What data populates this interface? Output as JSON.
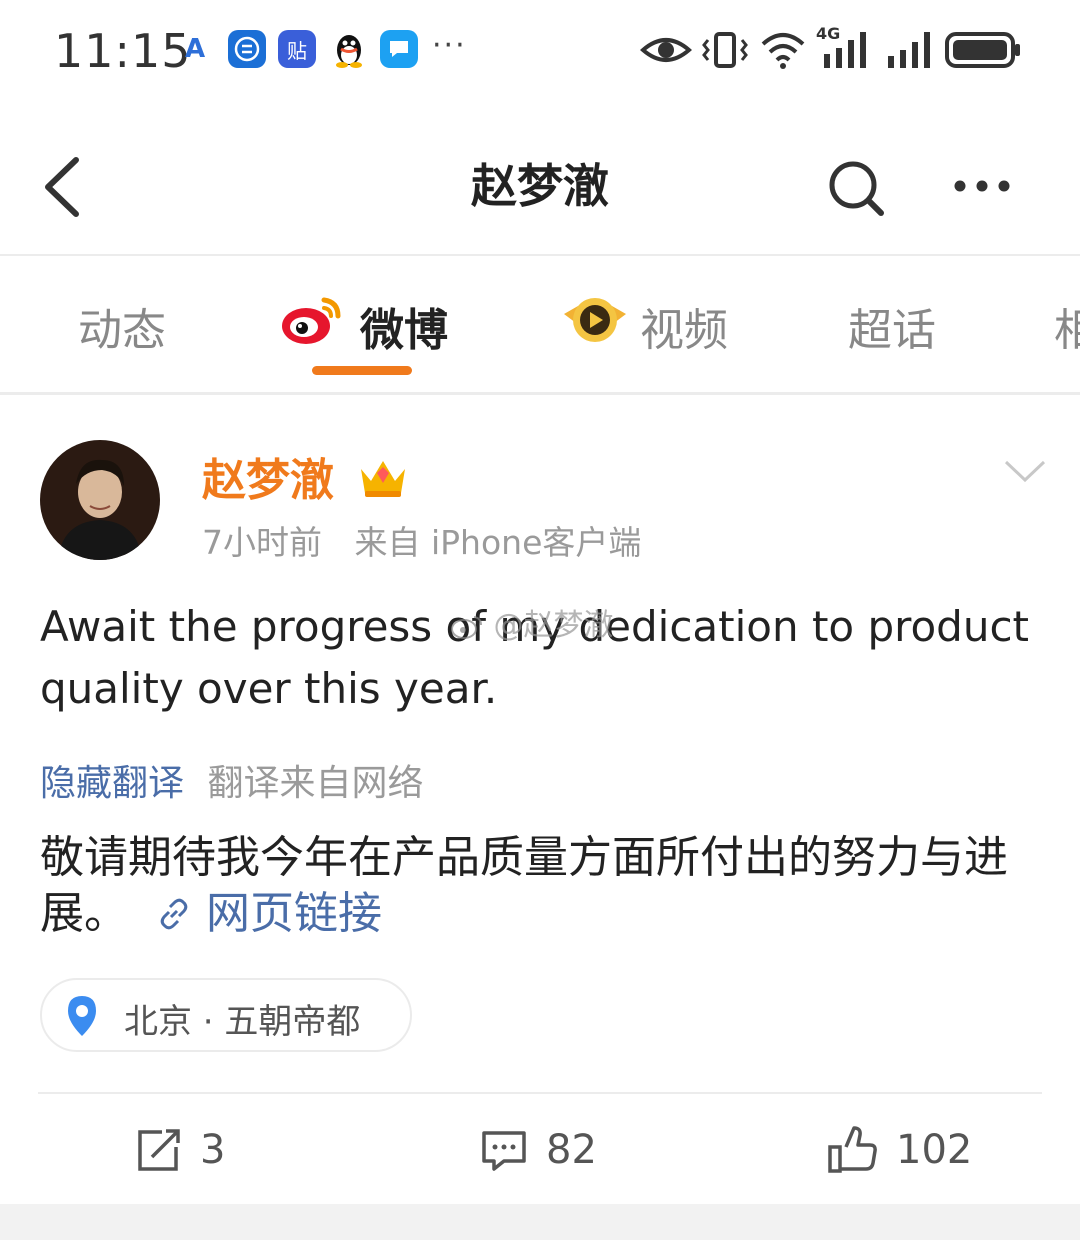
{
  "status_bar": {
    "time": "11:15",
    "notification_icons": [
      "a-icon",
      "list-app-icon",
      "tieba-icon",
      "qq-icon",
      "message-icon"
    ],
    "tieba_label": "贴",
    "more": "···",
    "network_label": "4G"
  },
  "nav": {
    "title": "赵梦澈"
  },
  "tabs": [
    {
      "label": "动态"
    },
    {
      "label": "微博"
    },
    {
      "label": "视频"
    },
    {
      "label": "超话"
    },
    {
      "label": "相"
    }
  ],
  "post": {
    "author": "赵梦澈",
    "time": "7小时前",
    "source": "来自 iPhone客户端",
    "text_en": "Await the progress of my dedication to product quality over this year.",
    "hide_translation": "隐藏翻译",
    "translation_source": "翻译来自网络",
    "text_cn": "敬请期待我今年在产品质量方面所付出的努力与进展。",
    "web_link": "网页链接",
    "location": "北京 · 五朝帝都",
    "watermark": "@赵梦澈"
  },
  "actions": {
    "reposts": "3",
    "comments": "82",
    "likes": "102"
  },
  "colors": {
    "accent": "#f07a1c",
    "link": "#4a6da8"
  }
}
